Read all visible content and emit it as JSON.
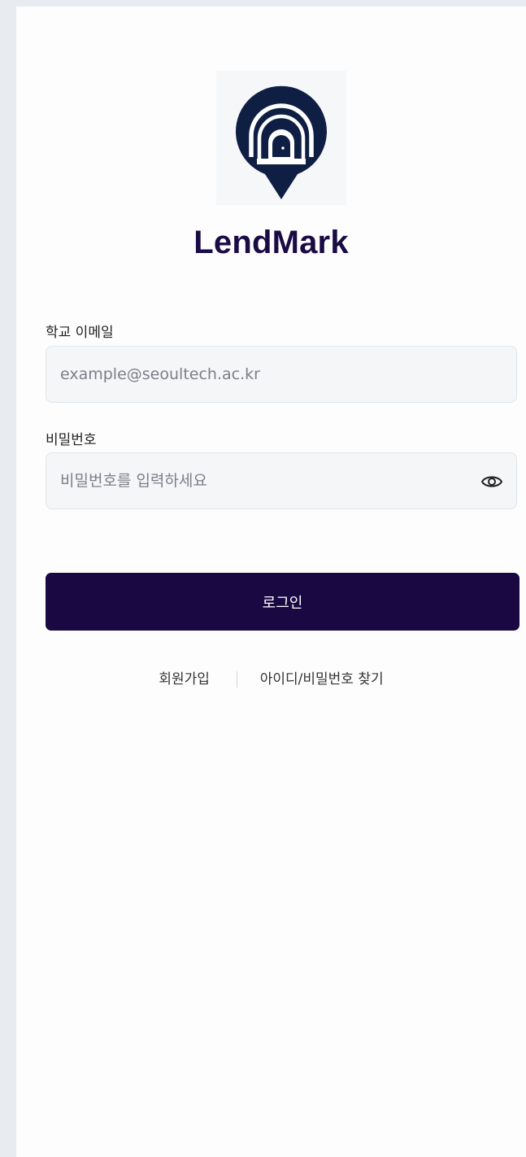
{
  "brand": {
    "name": "LendMark",
    "color": "#1a0b45",
    "logo_icon": "map-pin-door-icon"
  },
  "email": {
    "label": "학교 이메일",
    "value": "",
    "placeholder": "example@seoultech.ac.kr"
  },
  "password": {
    "label": "비밀번호",
    "value": "",
    "placeholder": "비밀번호를 입력하세요",
    "toggle_icon": "eye-icon"
  },
  "login_button": {
    "label": "로그인",
    "color": "#190841"
  },
  "links": {
    "signup": "회원가입",
    "find_account": "아이디/비밀번호 찾기"
  }
}
